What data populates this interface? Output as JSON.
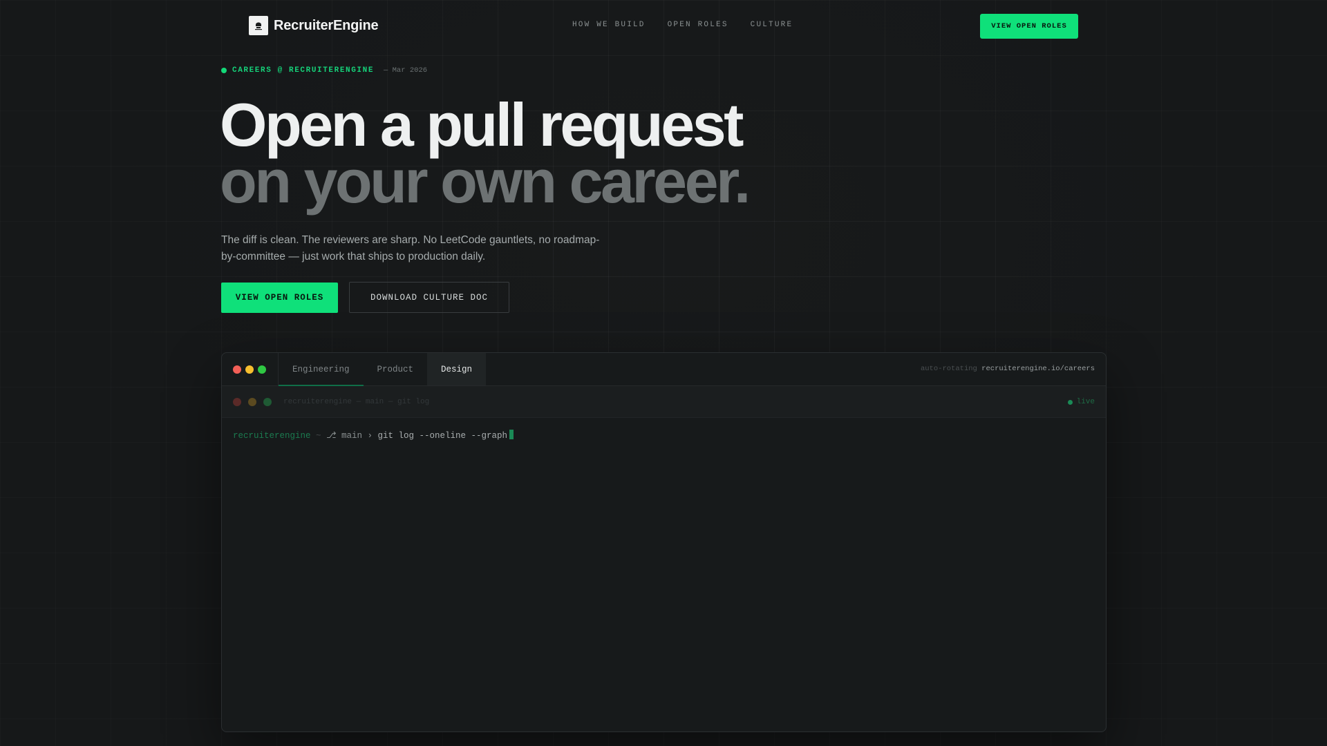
{
  "nav": {
    "brand": "RecruiterEngine",
    "logo_icon": "crab-logo-icon",
    "links": [
      "HOW WE BUILD",
      "OPEN ROLES",
      "CULTURE"
    ],
    "cta": "VIEW OPEN ROLES"
  },
  "hero": {
    "eyebrow": "CAREERS @ RECRUITERENGINE",
    "date": "— Mar 2026",
    "headline_line1": "Open a pull request",
    "headline_line2": "on your own career.",
    "lede": "The diff is clean. The reviewers are sharp. No LeetCode gauntlets, no roadmap-by-committee — just work that ships to production daily.",
    "primary_cta": "VIEW OPEN ROLES",
    "secondary_cta": "DOWNLOAD CULTURE DOC"
  },
  "panel": {
    "tabs": [
      "Engineering",
      "Product",
      "Design"
    ],
    "selected_tab": "Design",
    "meta_label": "auto-rotating",
    "meta_url": "recruiterengine.io/careers",
    "terminal_title": "recruiterengine — main — git log",
    "live_label": "live",
    "prompt": {
      "host": "recruiterengine",
      "tilde": "~",
      "branch": "⎇ main ›",
      "command": "git log --oneline --graph"
    }
  },
  "colors": {
    "accent": "#0fe07a",
    "background": "#181a1b"
  }
}
